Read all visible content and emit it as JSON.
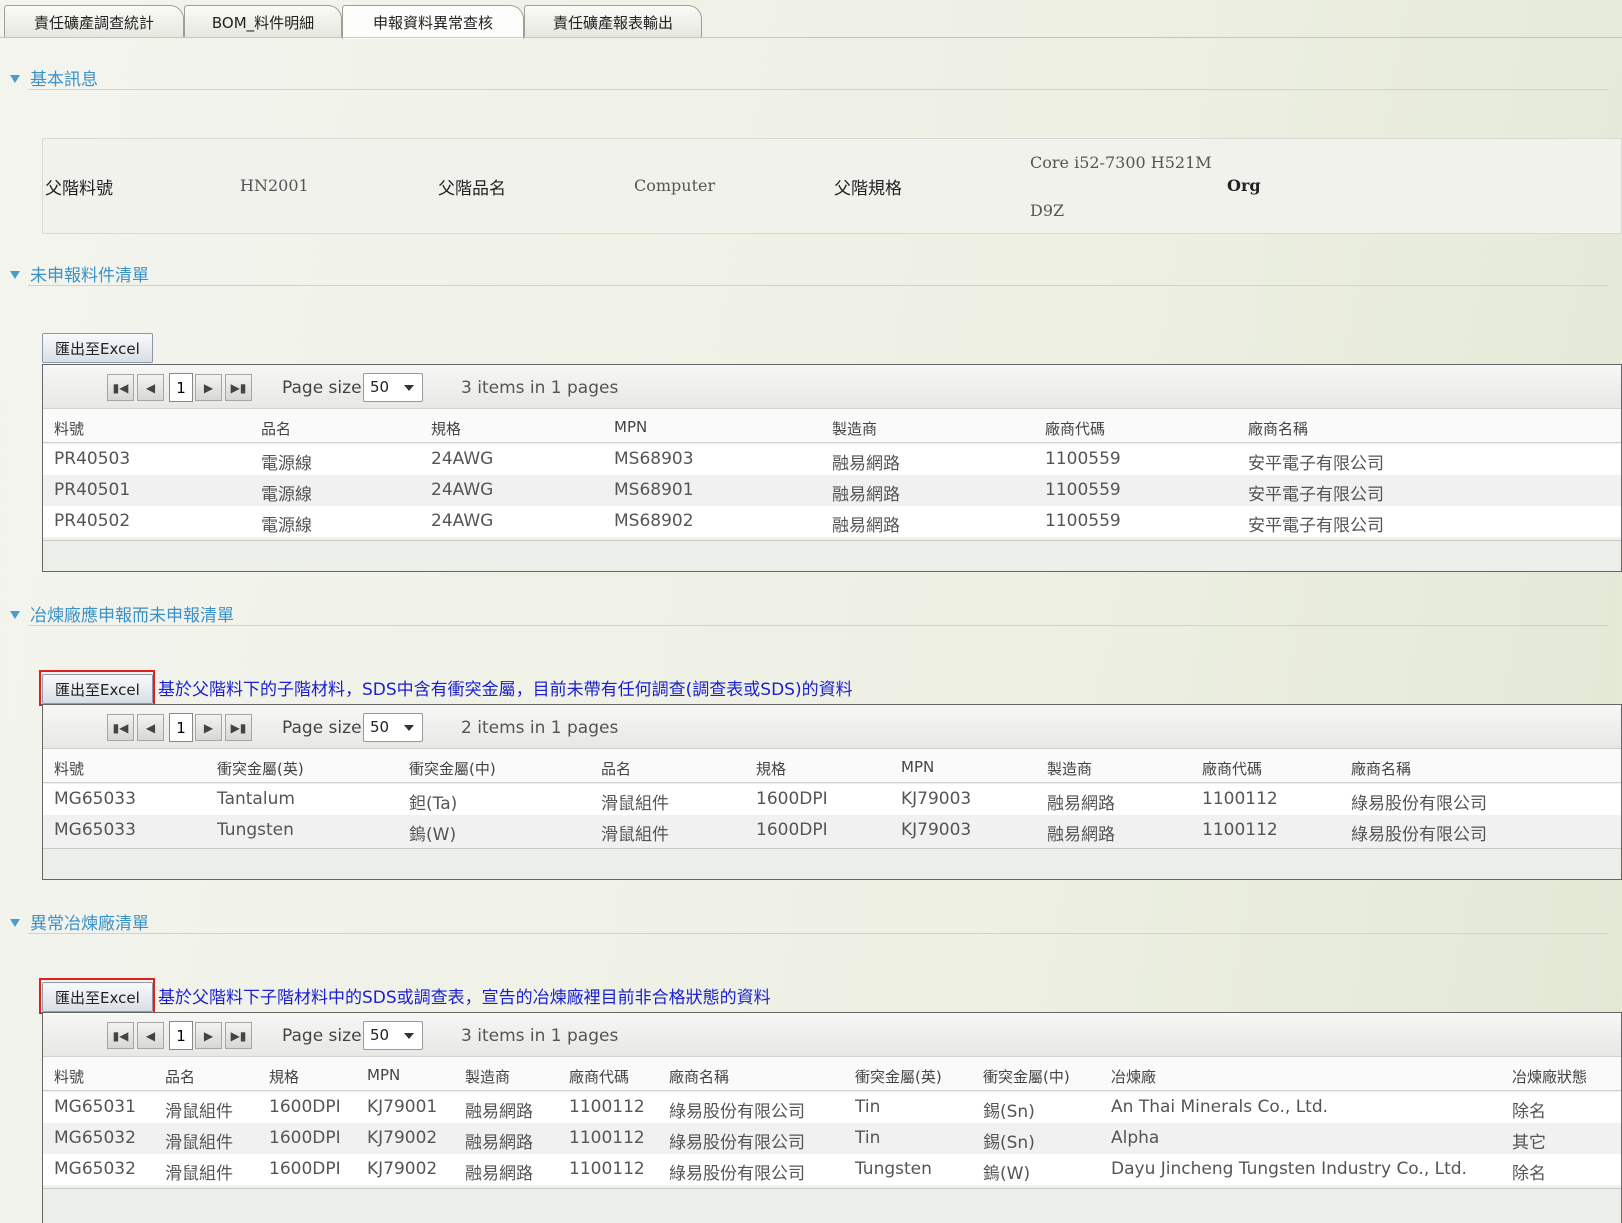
{
  "tabs": [
    {
      "label": "責任礦產調查統計",
      "active": false
    },
    {
      "label": "BOM_料件明細",
      "active": false
    },
    {
      "label": "申報資料異常查核",
      "active": true
    },
    {
      "label": "責任礦產報表輸出",
      "active": false
    }
  ],
  "basic": {
    "title": "基本訊息",
    "parent_no_label": "父階料號",
    "parent_no": "HN2001",
    "parent_name_label": "父階品名",
    "parent_name": "Computer",
    "parent_spec_label": "父階規格",
    "parent_spec_line1": "Core i52-7300 H521M",
    "parent_spec_line2": "D9Z",
    "org_label": "Org"
  },
  "unreported": {
    "title": "未申報料件清單",
    "export_label": "匯出至Excel",
    "pager": {
      "page": "1",
      "page_size_label": "Page size:",
      "page_size": "50",
      "info": "3 items in 1 pages"
    },
    "columns": [
      "料號",
      "品名",
      "規格",
      "MPN",
      "製造商",
      "廠商代碼",
      "廠商名稱"
    ],
    "rows": [
      [
        "PR40503",
        "電源線",
        "24AWG",
        "MS68903",
        "融易網路",
        "1100559",
        "安平電子有限公司"
      ],
      [
        "PR40501",
        "電源線",
        "24AWG",
        "MS68901",
        "融易網路",
        "1100559",
        "安平電子有限公司"
      ],
      [
        "PR40502",
        "電源線",
        "24AWG",
        "MS68902",
        "融易網路",
        "1100559",
        "安平電子有限公司"
      ]
    ]
  },
  "smelter_unreported": {
    "title": "冶煉廠應申報而未申報清單",
    "export_label": "匯出至Excel",
    "note": "基於父階料下的子階材料，SDS中含有衝突金屬，目前未帶有任何調查(調查表或SDS)的資料",
    "pager": {
      "page": "1",
      "page_size_label": "Page size:",
      "page_size": "50",
      "info": "2 items in 1 pages"
    },
    "columns": [
      "料號",
      "衝突金屬(英)",
      "衝突金屬(中)",
      "品名",
      "規格",
      "MPN",
      "製造商",
      "廠商代碼",
      "廠商名稱"
    ],
    "rows": [
      [
        "MG65033",
        "Tantalum",
        "鉭(Ta)",
        "滑鼠組件",
        "1600DPI",
        "KJ79003",
        "融易網路",
        "1100112",
        "綠易股份有限公司"
      ],
      [
        "MG65033",
        "Tungsten",
        "鎢(W)",
        "滑鼠組件",
        "1600DPI",
        "KJ79003",
        "融易網路",
        "1100112",
        "綠易股份有限公司"
      ]
    ]
  },
  "abnormal": {
    "title": "異常冶煉廠清單",
    "export_label": "匯出至Excel",
    "note": "基於父階料下子階材料中的SDS或調查表，宣告的冶煉廠裡目前非合格狀態的資料",
    "pager": {
      "page": "1",
      "page_size_label": "Page size:",
      "page_size": "50",
      "info": "3 items in 1 pages"
    },
    "columns": [
      "料號",
      "品名",
      "規格",
      "MPN",
      "製造商",
      "廠商代碼",
      "廠商名稱",
      "衝突金屬(英)",
      "衝突金屬(中)",
      "冶煉廠",
      "冶煉廠狀態"
    ],
    "rows": [
      [
        "MG65031",
        "滑鼠組件",
        "1600DPI",
        "KJ79001",
        "融易網路",
        "1100112",
        "綠易股份有限公司",
        "Tin",
        "錫(Sn)",
        "An Thai Minerals Co., Ltd.",
        "除名"
      ],
      [
        "MG65032",
        "滑鼠組件",
        "1600DPI",
        "KJ79002",
        "融易網路",
        "1100112",
        "綠易股份有限公司",
        "Tin",
        "錫(Sn)",
        "Alpha",
        "其它"
      ],
      [
        "MG65032",
        "滑鼠組件",
        "1600DPI",
        "KJ79002",
        "融易網路",
        "1100112",
        "綠易股份有限公司",
        "Tungsten",
        "鎢(W)",
        "Dayu Jincheng Tungsten Industry Co., Ltd.",
        "除名"
      ]
    ]
  }
}
